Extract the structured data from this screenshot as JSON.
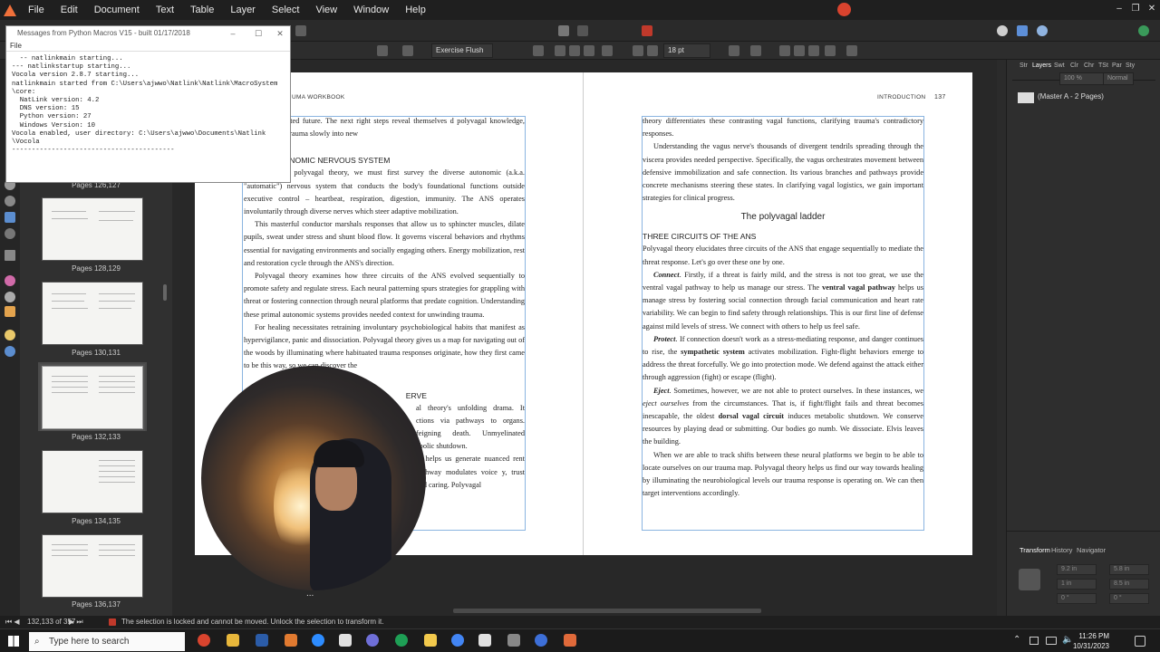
{
  "app": {
    "menu": [
      "File",
      "Edit",
      "Document",
      "Text",
      "Table",
      "Layer",
      "Select",
      "View",
      "Window",
      "Help"
    ]
  },
  "toolbar": {
    "style_name": "Exercise Flush",
    "font_size": "18 pt"
  },
  "macro_window": {
    "title": "Messages from Python Macros V15 - built 01/17/2018",
    "menu": "File",
    "log": "  -- natlinkmain starting...\n--- natlinkstartup starting...\nVocola version 2.8.7 starting...\nnatlinkmain started from C:\\Users\\ajwwo\\Natlink\\Natlink\\MacroSystem\n\\core:\n  NatLink version: 4.2\n  DNS version: 15\n  Python version: 27\n  Windows Version: 10\nVocola enabled, user directory: C:\\Users\\ajwwo\\Documents\\Natlink\n\\Vocola\n-----------------------------------------"
  },
  "pages_panel": {
    "items": [
      {
        "label": "Pages 126,127"
      },
      {
        "label": "Pages 128,129"
      },
      {
        "label": "Pages 130,131"
      },
      {
        "label": "Pages 132,133"
      },
      {
        "label": "Pages 134,135"
      },
      {
        "label": "Pages 136,137"
      }
    ]
  },
  "left_page": {
    "running_head": "UMA WORKBOOK",
    "p1": "ast and integrated future. The next right steps reveal themselves d polyvagal knowledge, traversing old trauma slowly into new",
    "heading": "F THE AUTONOMIC NERVOUS SYSTEM",
    "p2": "e comprehend polyvagal theory, we must first survey the diverse autonomic (a.k.a. \"automatic\") nervous system that conducts the body's foundational functions outside executive control – heartbeat, respiration, digestion, immunity. The ANS operates involuntarily through diverse nerves which steer adaptive mobilization.",
    "p3": "This masterful conductor marshals responses that allow us to sphincter muscles, dilate pupils, sweat under stress and shunt blood flow. It governs visceral behaviors and rhythms essential for navigating environments and socially engaging others. Energy mobilization, rest and restoration cycle through the ANS's direction.",
    "p4": "Polyvagal theory examines how three circuits of the ANS evolved sequentially to promote safety and regulate stress. Each neural patterning spurs strategies for grappling with threat or fostering connection through neural platforms that predate cognition. Understanding these primal autonomic systems provides needed context for unwinding trauma.",
    "p5": "For healing necessitates retraining involuntary psychobiological habits that manifest as hypervigilance, panic and dissociation. Polyvagal theory gives us a map for navigating out of the woods by illuminating where habituated trauma responses originate, how they first came to be this way, so we can discover the",
    "heading2": "ERVE",
    "p6": "al theory's unfolding drama. It ctions via pathways to organs. feigning death. Unmyelinated abolic shutdown.",
    "p7": "m helps us generate nuanced rent pathway modulates voice y, trust and caring. Polyvagal"
  },
  "right_page": {
    "running_head": "INTRODUCTION",
    "page_number": "137",
    "p1": "theory differentiates these contrasting vagal functions, clarifying trauma's contradictory responses.",
    "p2": "Understanding the vagus nerve's thousands of divergent tendrils spreading through the viscera provides needed perspective. Specifically, the vagus orchestrates movement between defensive immobilization and safe connection. Its various branches and pathways provide concrete mechanisms steering these states. In clarifying vagal logistics, we gain important strategies for clinical progress.",
    "title": "The polyvagal ladder",
    "heading": "THREE CIRCUITS OF THE ANS",
    "p3": "Polyvagal theory elucidates three circuits of the ANS that engage sequentially to mediate the threat response. Let's go over these one by one.",
    "connect_lead": "Connect",
    "connect_a": ". Firstly, if a threat is fairly mild, and the stress is not too great, we use the ventral vagal pathway to help us manage our stress. The ",
    "connect_bold": "ventral vagal pathway",
    "connect_b": " helps us manage stress by fostering social connection through facial communication and heart rate variability. We can begin to find safety through relationships. This is our first line of defense against mild levels of stress. We connect with others to help us feel safe.",
    "protect_lead": "Protect",
    "protect_a": ". If connection doesn't work as a stress-mediating response, and danger continues to rise, the ",
    "protect_bold": "sympathetic system",
    "protect_b": " activates mobilization. Fight-flight behaviors emerge to address the threat forcefully. We go into protection mode. We defend against the attack either through aggression (fight) or escape (flight).",
    "eject_lead": "Eject",
    "eject_a": ". Sometimes, however, we are not able to protect ourselves. In these instances, we ",
    "eject_italic": "eject ourselves",
    "eject_b": " from the circumstances. That is, if fight/flight fails and threat becomes inescapable, the oldest ",
    "eject_bold": "dorsal vagal circuit",
    "eject_c": " induces metabolic shutdown. We conserve resources by playing dead or submitting. Our bodies go numb. We dissociate. Elvis leaves the building.",
    "p4": "When we are able to track shifts between these neural platforms we begin to be able to locate ourselves on our trauma map. Polyvagal theory helps us find our way towards healing by illuminating the neurobiological levels our trauma response is operating on. We can then target interventions accordingly."
  },
  "right_panel": {
    "tabs": [
      "Str",
      "Layers",
      "Swt",
      "Clr",
      "Chr",
      "TSt",
      "Par",
      "Sty"
    ],
    "opacity": "100 %",
    "blend": "Normal",
    "layer_label": "(Master A - 2 Pages)",
    "bottom_tabs": [
      "Transform",
      "History",
      "Navigator"
    ],
    "transform": {
      "x": "9.2 in",
      "y": "5.8 in",
      "w": "1 in",
      "h": "8.5 in",
      "r": "0 °",
      "s": "0 °"
    }
  },
  "status": {
    "page_indicator": "132,133 of 357",
    "message": "The selection is locked and cannot be moved. Unlock the selection to transform it."
  },
  "taskbar": {
    "search_placeholder": "Type here to search",
    "time": "11:26 PM",
    "date": "10/31/2023"
  },
  "webcam": {
    "more": "..."
  }
}
